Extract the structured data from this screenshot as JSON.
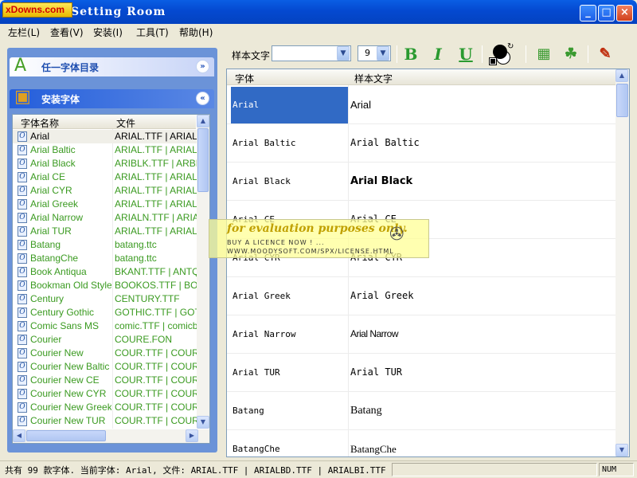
{
  "window": {
    "title": "Font Setting Room",
    "logo_text": "xDowns.com"
  },
  "menu": [
    "左栏(L)",
    "查看(V)",
    "安装(I)",
    "工具(T)",
    "帮助(H)"
  ],
  "toolbar": {
    "sample_label": "样本文字",
    "sample_value": "",
    "size_value": "9"
  },
  "left_panel": {
    "section1_title": "任一字体目录",
    "section2_title": "安装字体",
    "col_name": "字体名称",
    "col_file": "文件",
    "fonts": [
      {
        "name": "Arial",
        "file": "ARIAL.TTF | ARIALBD.TTF"
      },
      {
        "name": "Arial Baltic",
        "file": "ARIAL.TTF | ARIALBD.TTF"
      },
      {
        "name": "Arial Black",
        "file": "ARIBLK.TTF | ARBLI_"
      },
      {
        "name": "Arial CE",
        "file": "ARIAL.TTF | ARIALBD.TTF"
      },
      {
        "name": "Arial CYR",
        "file": "ARIAL.TTF | ARIALBD.TTF"
      },
      {
        "name": "Arial Greek",
        "file": "ARIAL.TTF | ARIALBD.TTF"
      },
      {
        "name": "Arial Narrow",
        "file": "ARIALN.TTF | ARIALNB.TTF"
      },
      {
        "name": "Arial TUR",
        "file": "ARIAL.TTF | ARIALBD.TTF"
      },
      {
        "name": "Batang",
        "file": "batang.ttc"
      },
      {
        "name": "BatangChe",
        "file": "batang.ttc"
      },
      {
        "name": "Book Antiqua",
        "file": "BKANT.TTF | ANTQUAB.TTF"
      },
      {
        "name": "Bookman Old Style",
        "file": "BOOKOS.TTF | BOOKOSB.TTF"
      },
      {
        "name": "Century",
        "file": "CENTURY.TTF"
      },
      {
        "name": "Century Gothic",
        "file": "GOTHIC.TTF | GOTHICB.TTF"
      },
      {
        "name": "Comic Sans MS",
        "file": "comic.TTF | comicbd.TTF"
      },
      {
        "name": "Courier",
        "file": "COURE.FON"
      },
      {
        "name": "Courier New",
        "file": "COUR.TTF | COURBD.TTF"
      },
      {
        "name": "Courier New Baltic",
        "file": "COUR.TTF | COURBD.TTF"
      },
      {
        "name": "Courier New CE",
        "file": "COUR.TTF | COURBD.TTF"
      },
      {
        "name": "Courier New CYR",
        "file": "COUR.TTF | COURBD.TTF"
      },
      {
        "name": "Courier New Greek",
        "file": "COUR.TTF | COURBD.TTF"
      },
      {
        "name": "Courier New TUR",
        "file": "COUR.TTF | COURBD.TTF"
      }
    ]
  },
  "preview": {
    "col_font": "字体",
    "col_sample": "样本文字",
    "rows": [
      {
        "font": "Arial",
        "sample": "Arial"
      },
      {
        "font": "Arial Baltic",
        "sample": "Arial Baltic"
      },
      {
        "font": "Arial Black",
        "sample": "Arial Black"
      },
      {
        "font": "Arial CE",
        "sample": "Arial CE"
      },
      {
        "font": "Arial CYR",
        "sample": "Arial CYR"
      },
      {
        "font": "Arial Greek",
        "sample": "Arial Greek"
      },
      {
        "font": "Arial Narrow",
        "sample": "Arial Narrow"
      },
      {
        "font": "Arial TUR",
        "sample": "Arial TUR"
      },
      {
        "font": "Batang",
        "sample": "Batang"
      },
      {
        "font": "BatangChe",
        "sample": "BatangChe"
      }
    ]
  },
  "watermark": {
    "line1": "for evaluation purposes only.",
    "line2": "BUY A LICENCE NOW ! ...",
    "line3": "WWW.MOODYSOFT.COM/SPX/LICENSE.HTML"
  },
  "status": {
    "text": "共有 99 款字体. 当前字体: Arial, 文件: ARIAL.TTF | ARIALBD.TTF | ARIALBI.TTF | A",
    "num": "NUM"
  }
}
